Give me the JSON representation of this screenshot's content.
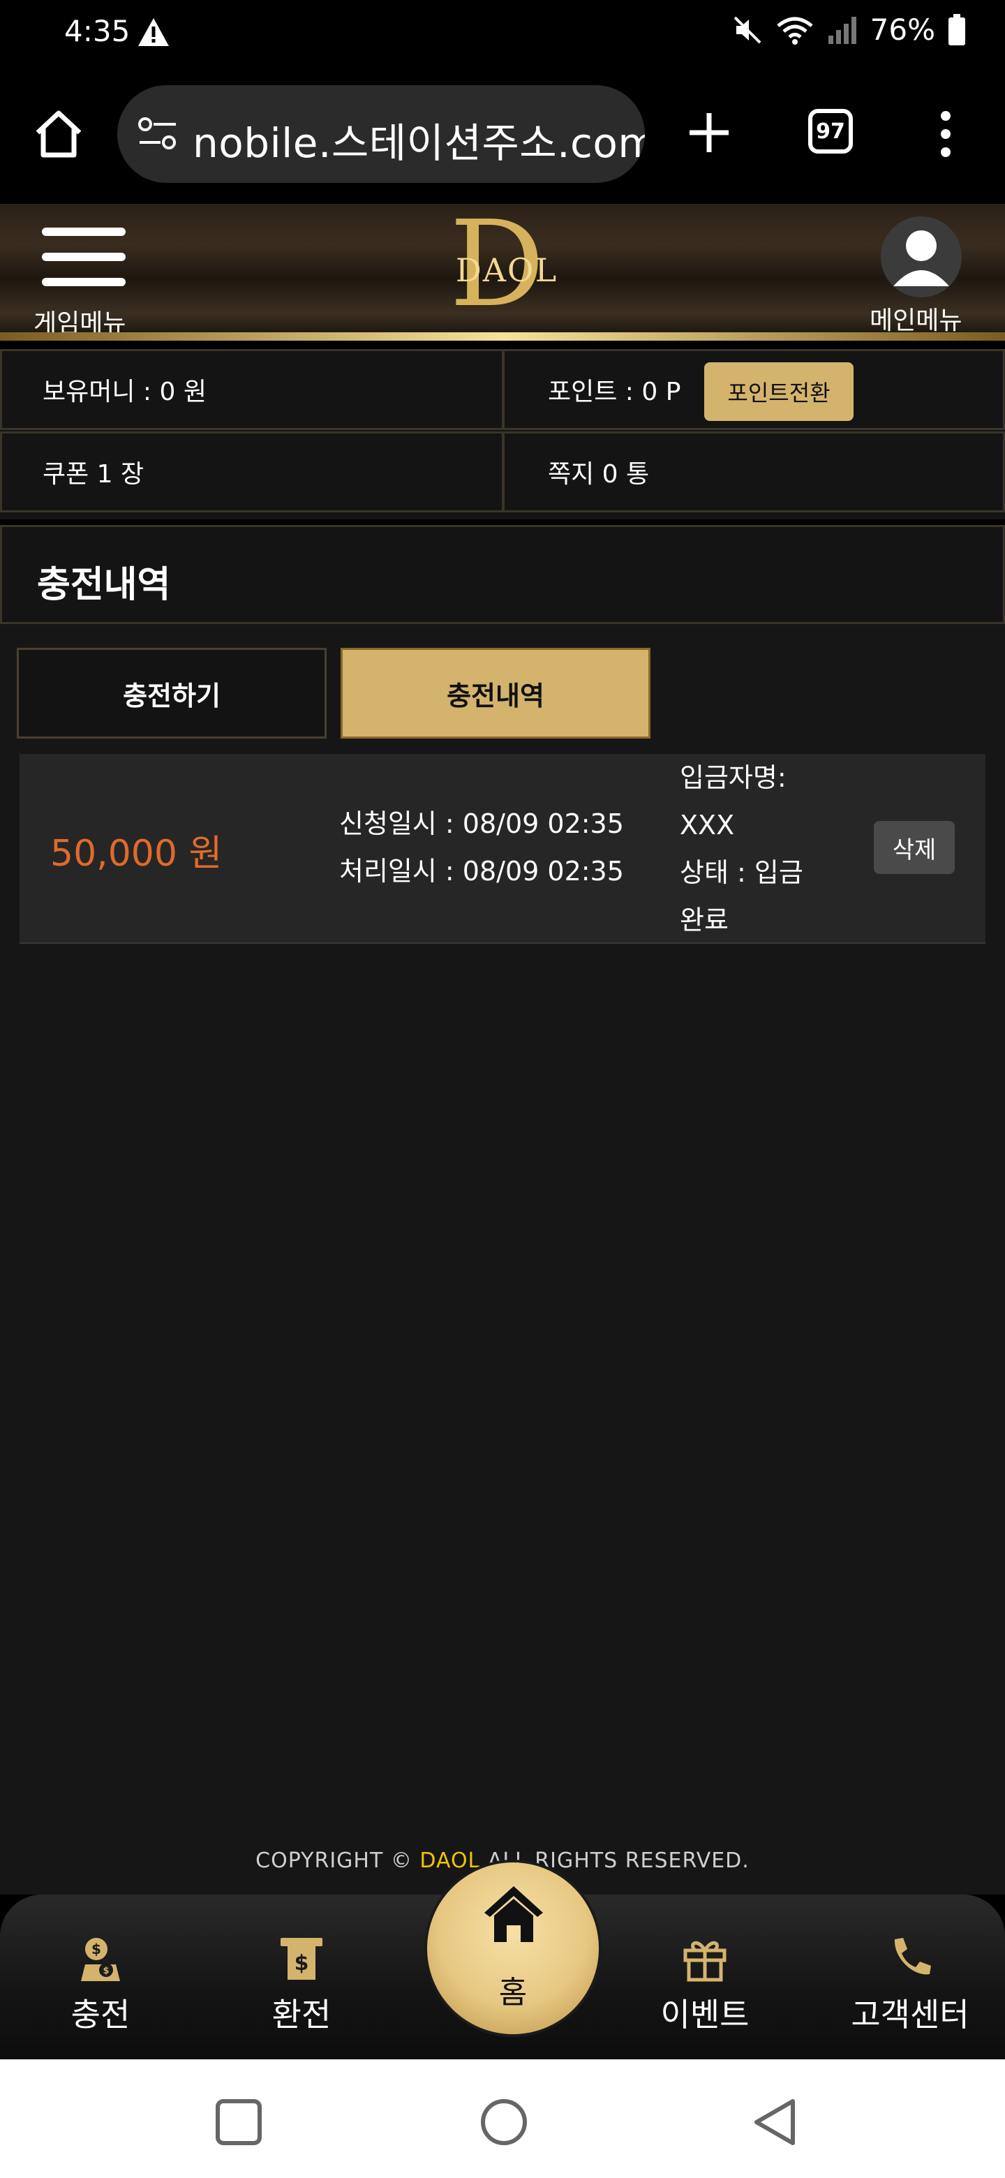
{
  "status_bar": {
    "time": "4:35",
    "battery": "76%"
  },
  "browser": {
    "url": "nobile.스테이션주소.com",
    "tab_count": "97"
  },
  "header": {
    "left_menu_label": "게임메뉴",
    "right_menu_label": "메인메뉴",
    "logo_text": "DAOL"
  },
  "info": {
    "balance": "보유머니 : 0 원",
    "points": "포인트 : 0 P",
    "point_convert_button": "포인트전환",
    "coupons": "쿠폰 1 장",
    "messages": "쪽지 0 통"
  },
  "page_title": "충전내역",
  "tabs": [
    {
      "label": "충전하기",
      "active": false
    },
    {
      "label": "충전내역",
      "active": true
    }
  ],
  "records": [
    {
      "amount": "50,000 원",
      "requested": "신청일시 : 08/09 02:35",
      "processed": "처리일시 : 08/09 02:35",
      "depositor_label": "입금자명:",
      "depositor": "XXX",
      "status_line1": "상태 : 입금",
      "status_line2": "완료",
      "delete_label": "삭제"
    }
  ],
  "copyright": {
    "prefix": "COPYRIGHT © ",
    "brand": "DAOL",
    "suffix": " ALL RIGHTS RESERVED."
  },
  "bottom_nav": {
    "charge": "충전",
    "exchange": "환전",
    "home": "홈",
    "event": "이벤트",
    "support": "고객센터"
  },
  "colors": {
    "gold": "#d4b46d",
    "amount": "#e06a2c",
    "brand_yellow": "#f0c400"
  }
}
